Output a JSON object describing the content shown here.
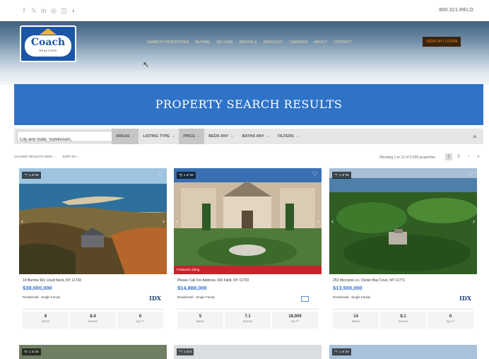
{
  "topbar": {
    "social_icons": [
      "facebook-icon",
      "twitter-icon",
      "linkedin-icon",
      "pinterest-icon",
      "instagram-icon",
      "rss-icon"
    ],
    "social_glyphs": [
      "f",
      "𝕏",
      "in",
      "◎",
      "◫",
      "◗"
    ],
    "phone": "800.321.RELO"
  },
  "header": {
    "logo_text": "Coach",
    "logo_subtext": "REALTORS",
    "nav": [
      "SEARCH PROPERTIES",
      "BUYING",
      "SELLING",
      "RENTALS",
      "SERVICES",
      "CAREERS",
      "ABOUT",
      "CONTACT"
    ],
    "signup_label": "SIGN UP / LOGIN"
  },
  "banner": {
    "title": "PROPERTY SEARCH RESULTS"
  },
  "filters": {
    "search_value": "City and State, Subdivision,",
    "areas": "AREAS",
    "listing_type": "LISTING TYPE",
    "price": "PRICE",
    "beds": "BEDS ANY",
    "baths": "BATHS ANY",
    "more": "FILTERS"
  },
  "results": {
    "change_view": "CHANGE RESULTS VIEW",
    "sort_by": "SORT BY",
    "showing": "Showing 1 to 12 of 5,000 properties",
    "pages": [
      "1",
      "2"
    ]
  },
  "listings": [
    {
      "photo_count": "1 of 25",
      "address": "19 Burrine Rd, Lloyd Neck, NY 11743",
      "price": "$38,000,000",
      "type": "Residential - Single Family",
      "featured": "",
      "beds": "8",
      "baths": "8.4",
      "sqft": "0",
      "beds_label": "BEDS",
      "baths_label": "BATHS",
      "sqft_label": "SQ FT"
    },
    {
      "photo_count": "1 of 33",
      "address": "Please Call For Address, Old Field, NY 11733",
      "price": "$14,888,000",
      "type": "Residential - Single Family",
      "featured": "Featured Listing",
      "beds": "5",
      "baths": "7.1",
      "sqft": "18,000",
      "beds_label": "BEDS",
      "baths_label": "BATHS",
      "sqft_label": "SQ FT"
    },
    {
      "photo_count": "1 of 25",
      "address": "253 Mccoune Ln, Oyster Bay Cove, NY 11771",
      "price": "$13,500,000",
      "type": "Residential - Single Family",
      "featured": "",
      "beds": "14",
      "baths": "8.1",
      "sqft": "0",
      "beds_label": "BEDS",
      "baths_label": "BATHS",
      "sqft_label": "SQ FT"
    }
  ],
  "lower_listings": [
    {
      "photo_count": "1 of 25"
    },
    {
      "photo_count": "1 of 6"
    },
    {
      "photo_count": "1 of 20"
    }
  ],
  "colors": {
    "brand_blue": "#2f73c7",
    "signup_bg": "#3b2410",
    "signup_text": "#f08a1c",
    "featured_red": "#c8232d"
  }
}
